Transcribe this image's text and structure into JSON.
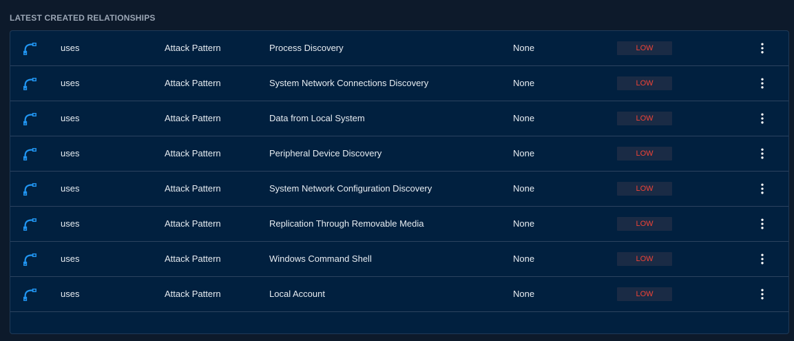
{
  "section": {
    "title": "LATEST CREATED RELATIONSHIPS"
  },
  "colors": {
    "background": "#0d1a2b",
    "panel": "#01203f",
    "icon_accent": "#2196f3",
    "low_badge_text": "#f44336",
    "low_badge_bg": "#1a2b45"
  },
  "icons": {
    "relationship": "relationship-icon",
    "menu": "more-vert-icon"
  },
  "rows": [
    {
      "type": "uses",
      "entity_type": "Attack Pattern",
      "name": "Process Discovery",
      "extra": "None",
      "level": "LOW"
    },
    {
      "type": "uses",
      "entity_type": "Attack Pattern",
      "name": "System Network Connections Discovery",
      "extra": "None",
      "level": "LOW"
    },
    {
      "type": "uses",
      "entity_type": "Attack Pattern",
      "name": "Data from Local System",
      "extra": "None",
      "level": "LOW"
    },
    {
      "type": "uses",
      "entity_type": "Attack Pattern",
      "name": "Peripheral Device Discovery",
      "extra": "None",
      "level": "LOW"
    },
    {
      "type": "uses",
      "entity_type": "Attack Pattern",
      "name": "System Network Configuration Discovery",
      "extra": "None",
      "level": "LOW"
    },
    {
      "type": "uses",
      "entity_type": "Attack Pattern",
      "name": "Replication Through Removable Media",
      "extra": "None",
      "level": "LOW"
    },
    {
      "type": "uses",
      "entity_type": "Attack Pattern",
      "name": "Windows Command Shell",
      "extra": "None",
      "level": "LOW"
    },
    {
      "type": "uses",
      "entity_type": "Attack Pattern",
      "name": "Local Account",
      "extra": "None",
      "level": "LOW"
    }
  ]
}
